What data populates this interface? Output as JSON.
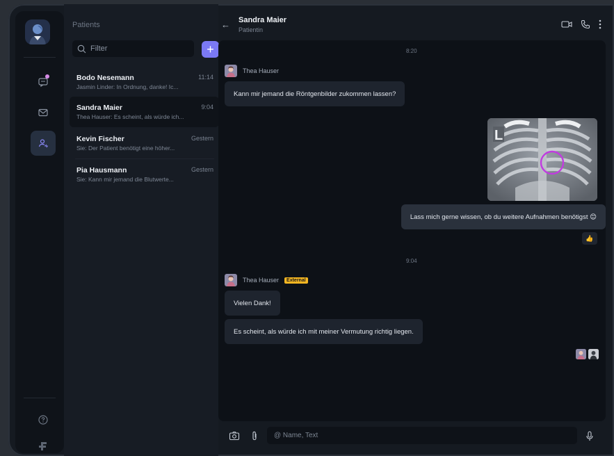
{
  "sidebar": {
    "items": [
      {
        "icon": "chat-icon",
        "active": false,
        "unread_dot": true
      },
      {
        "icon": "mail-icon",
        "active": false
      },
      {
        "icon": "patients-icon",
        "active": true
      }
    ],
    "bottom": [
      {
        "icon": "help-icon"
      },
      {
        "icon": "logo-icon"
      }
    ]
  },
  "patients_panel": {
    "title": "Patients",
    "filter_placeholder": "Filter",
    "add_label": "+",
    "conversations": [
      {
        "name": "Bodo Nesemann",
        "time": "11:14",
        "preview": "Jasmin Linder: In Ordnung, danke! Ic...",
        "active": false
      },
      {
        "name": "Sandra Maier",
        "time": "9:04",
        "preview": "Thea Hauser: Es scheint, als würde ich...",
        "active": true
      },
      {
        "name": "Kevin Fischer",
        "time": "Gestern",
        "preview": "Sie: Der Patient benötigt eine höher...",
        "active": false
      },
      {
        "name": "Pia Hausmann",
        "time": "Gestern",
        "preview": "Sie: Kann mir jemand die Blutwerte...",
        "active": false
      }
    ]
  },
  "header": {
    "back": "←",
    "name": "Sandra Maier",
    "subtitle": "Patientin",
    "actions": [
      "video-icon",
      "phone-icon",
      "more-icon"
    ]
  },
  "chat": {
    "timestamps": [
      "8:20",
      "9:04"
    ],
    "messages": [
      {
        "sender": "Thea Hauser",
        "text": "Kann mir jemand die Röntgenbilder zukommen lassen?"
      },
      {
        "attachment": "xray-image",
        "marker": "L"
      },
      {
        "sender": "me",
        "text": "Lass mich gerne wissen, ob du weitere Aufnahmen benötigst 😊",
        "reaction": "👍"
      },
      {
        "sender": "Thea Hauser",
        "badge": "External",
        "text": "Vielen Dank!"
      },
      {
        "sender": "Thea Hauser",
        "text": "Es scheint, als würde ich mit meiner Vermutung richtig liegen."
      }
    ]
  },
  "composer": {
    "placeholder": "@ Name, Text",
    "icons": [
      "camera-icon",
      "attachment-icon",
      "microphone-icon"
    ]
  },
  "colors": {
    "accent": "#7b79f4",
    "badge": "#f5b622",
    "highlight_circle": "#c13be0"
  }
}
